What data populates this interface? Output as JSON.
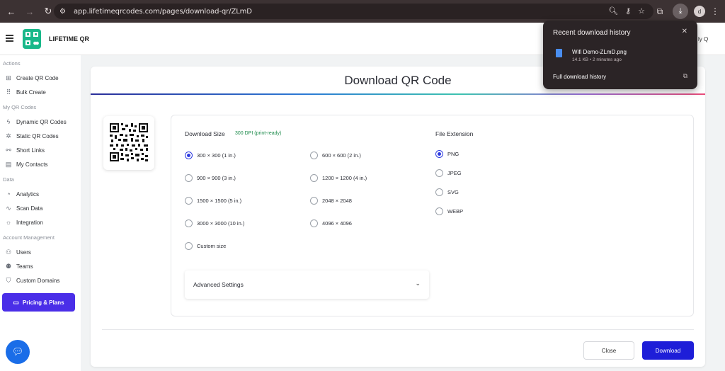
{
  "browser": {
    "url": "app.lifetimeqrcodes.com/pages/download-qr/ZLmD",
    "profile_initial": "d"
  },
  "header": {
    "brand": "LIFETIME QR",
    "user_partial": "ly Q"
  },
  "sidebar": {
    "sections": [
      {
        "label": "Actions",
        "items": [
          {
            "label": "Create QR Code",
            "icon": "plus-square-icon"
          },
          {
            "label": "Bulk Create",
            "icon": "grid-icon"
          }
        ]
      },
      {
        "label": "My QR Codes",
        "items": [
          {
            "label": "Dynamic QR Codes",
            "icon": "lightning-icon"
          },
          {
            "label": "Static QR Codes",
            "icon": "sparkle-icon"
          },
          {
            "label": "Short Links",
            "icon": "link-icon"
          },
          {
            "label": "My Contacts",
            "icon": "contacts-icon"
          }
        ]
      },
      {
        "label": "Data",
        "items": [
          {
            "label": "Analytics",
            "icon": "pie-chart-icon"
          },
          {
            "label": "Scan Data",
            "icon": "activity-icon"
          },
          {
            "label": "Integration",
            "icon": "bulb-icon"
          }
        ]
      },
      {
        "label": "Account Management",
        "items": [
          {
            "label": "Users",
            "icon": "user-add-icon"
          },
          {
            "label": "Teams",
            "icon": "team-icon"
          },
          {
            "label": "Custom Domains",
            "icon": "shield-icon"
          }
        ]
      }
    ],
    "pricing_label": "Pricing & Plans"
  },
  "main": {
    "title": "Download QR Code",
    "size_heading": "Download Size",
    "dpi_note": "300 DPI (print-ready)",
    "sizes_left": [
      "300 × 300 (1 in.)",
      "900 × 900 (3 in.)",
      "1500 × 1500 (5 in.)",
      "3000 × 3000 (10 in.)",
      "Custom size"
    ],
    "sizes_right": [
      "600 × 600 (2 in.)",
      "1200 × 1200 (4 in.)",
      "2048 × 2048",
      "4096 × 4096"
    ],
    "selected_size": "300 × 300 (1 in.)",
    "ext_heading": "File Extension",
    "extensions": [
      "PNG",
      "JPEG",
      "SVG",
      "WEBP"
    ],
    "selected_ext": "PNG",
    "advanced_label": "Advanced Settings",
    "close_label": "Close",
    "download_label": "Download"
  },
  "download_popup": {
    "title": "Recent download history",
    "file_name": "Wifi Demo-ZLmD.png",
    "file_meta": "14.1 KB • 2 minutes ago",
    "full_history": "Full download history"
  },
  "colors": {
    "accent": "#1e1ed8",
    "pricing": "#4a2ee8",
    "brand_green": "#19b88a"
  }
}
